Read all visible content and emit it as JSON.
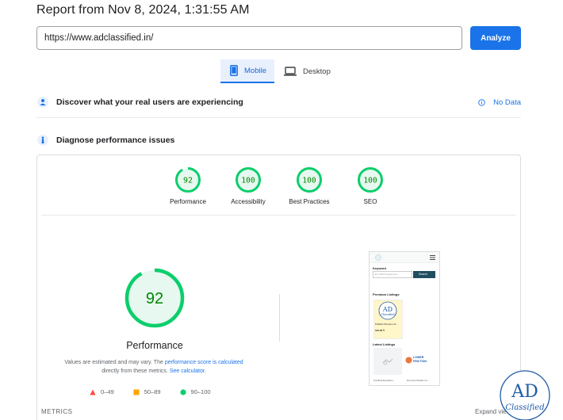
{
  "report": {
    "title": "Report from Nov 8, 2024, 1:31:55 AM"
  },
  "url_bar": {
    "value": "https://www.adclassified.in/",
    "analyze_label": "Analyze"
  },
  "tabs": [
    {
      "label": "Mobile",
      "icon": "smartphone-icon",
      "active": true
    },
    {
      "label": "Desktop",
      "icon": "laptop-icon",
      "active": false
    }
  ],
  "sections": {
    "discover": {
      "label": "Discover what your real users are experiencing",
      "status": "No Data",
      "icon": "users-icon"
    },
    "diagnose": {
      "label": "Diagnose performance issues",
      "icon": "lighthouse-icon"
    }
  },
  "scores": [
    {
      "name": "Performance",
      "value": "92",
      "pct": 92
    },
    {
      "name": "Accessibility",
      "value": "100",
      "pct": 100
    },
    {
      "name": "Best Practices",
      "value": "100",
      "pct": 100
    },
    {
      "name": "SEO",
      "value": "100",
      "pct": 100
    }
  ],
  "main_score": {
    "value": "92",
    "label": "Performance",
    "pct": 92
  },
  "note": {
    "prefix": "Values are estimated and may vary. The ",
    "link1": "performance score is calculated",
    "middle": " directly from these metrics. ",
    "link2": "See calculator."
  },
  "legend": [
    {
      "range": "0–49",
      "color": "#ff4e42",
      "shape": "triangle"
    },
    {
      "range": "50–89",
      "color": "#ffa400",
      "shape": "square"
    },
    {
      "range": "90–100",
      "color": "#0cce6b",
      "shape": "circle"
    }
  ],
  "thumbnail": {
    "keyword_label": "Keyword",
    "search_placeholder": "Ex: PHP Programmer",
    "search_button": "Search",
    "premium_title": "Premium Listings",
    "premium_item": "Publish Premium Cl...",
    "premium_price": "100.00 ₹",
    "latest_title": "Latest Listings",
    "latest_item1": "Top Branding Attem...",
    "latest_item2": "Dry Lane Powder Co...",
    "lower_friction": "LOWER FRICTION"
  },
  "metrics": {
    "label": "METRICS",
    "expand": "Expand view"
  },
  "logo": {
    "top": "AD",
    "bottom": "Classified"
  },
  "colors": {
    "accent": "#1a73e8",
    "pass": "#0cce6b",
    "pass_text": "#008800",
    "pass_fill": "#e6f8ef"
  }
}
